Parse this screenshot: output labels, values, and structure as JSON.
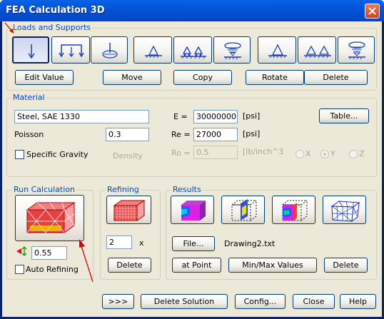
{
  "window": {
    "title": "FEA Calculation 3D"
  },
  "loads": {
    "group_label": "Loads and Supports",
    "tools": [
      "load-single-arrow-icon",
      "load-distributed-arrows-icon",
      "load-point-disc-icon",
      "support-fixed-triangle-icon",
      "support-roller-double-icon",
      "support-spring-dish-icon",
      "support-fixed-triangle-alt-icon",
      "support-double-triangle-icon",
      "support-spring-alt-icon"
    ],
    "buttons": {
      "edit": "Edit Value",
      "move": "Move",
      "copy": "Copy",
      "rotate": "Rotate",
      "delete": "Delete"
    }
  },
  "material": {
    "group_label": "Material",
    "name_value": "Steel, SAE 1330",
    "e_label": "E =",
    "e_value": "30000000",
    "e_unit": "[psi]",
    "re_label": "Re =",
    "re_value": "27000",
    "re_unit": "[psi]",
    "ro_label": "Ro =",
    "ro_value": "0.5",
    "ro_unit": "[lb/inch^3",
    "poisson_label": "Poisson",
    "poisson_value": "0.3",
    "specific_gravity_label": "Specific Gravity",
    "density_label": "Density",
    "table_button": "Table...",
    "axis_x": "X",
    "axis_y": "Y",
    "axis_z": "Z"
  },
  "run": {
    "group_label": "Run Calculation",
    "tolerance_value": "0.55",
    "auto_refining_label": "Auto Refining"
  },
  "refining": {
    "group_label": "Refining",
    "factor_value": "2",
    "factor_unit": "x",
    "delete_button": "Delete"
  },
  "results": {
    "group_label": "Results",
    "file_button": "File...",
    "file_name": "Drawing2.txt",
    "at_point_button": "at Point",
    "minmax_button": "Min/Max Values",
    "delete_button": "Delete"
  },
  "footer": {
    "more_button": ">>>",
    "delete_solution_button": "Delete Solution",
    "config_button": "Config...",
    "close_button": "Close",
    "help_button": "Help"
  }
}
